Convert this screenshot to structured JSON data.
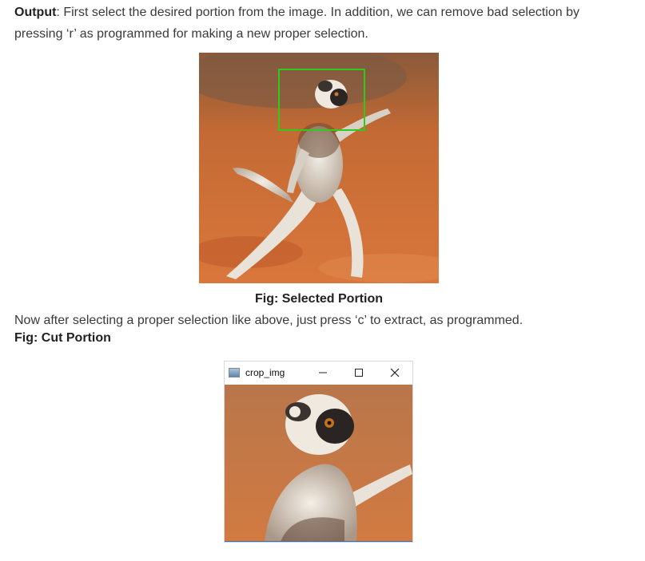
{
  "intro": {
    "label": "Output",
    "text": ": First select the desired portion from the image. In addition, we can remove bad selection by pressing ‘r’ as programmed for making a new proper selection."
  },
  "figure1": {
    "caption": "Fig: Selected Portion"
  },
  "middle": {
    "text": "Now after selecting a proper selection like above, just press ‘c’ to extract, as programmed."
  },
  "figure2": {
    "caption": "Fig: Cut Portion"
  },
  "window": {
    "title": "crop_img",
    "icons": [
      "app-icon",
      "minimize-icon",
      "maximize-icon",
      "close-icon"
    ]
  },
  "colors": {
    "selection_box": "#2ecc18",
    "ground": "#c8622c"
  }
}
